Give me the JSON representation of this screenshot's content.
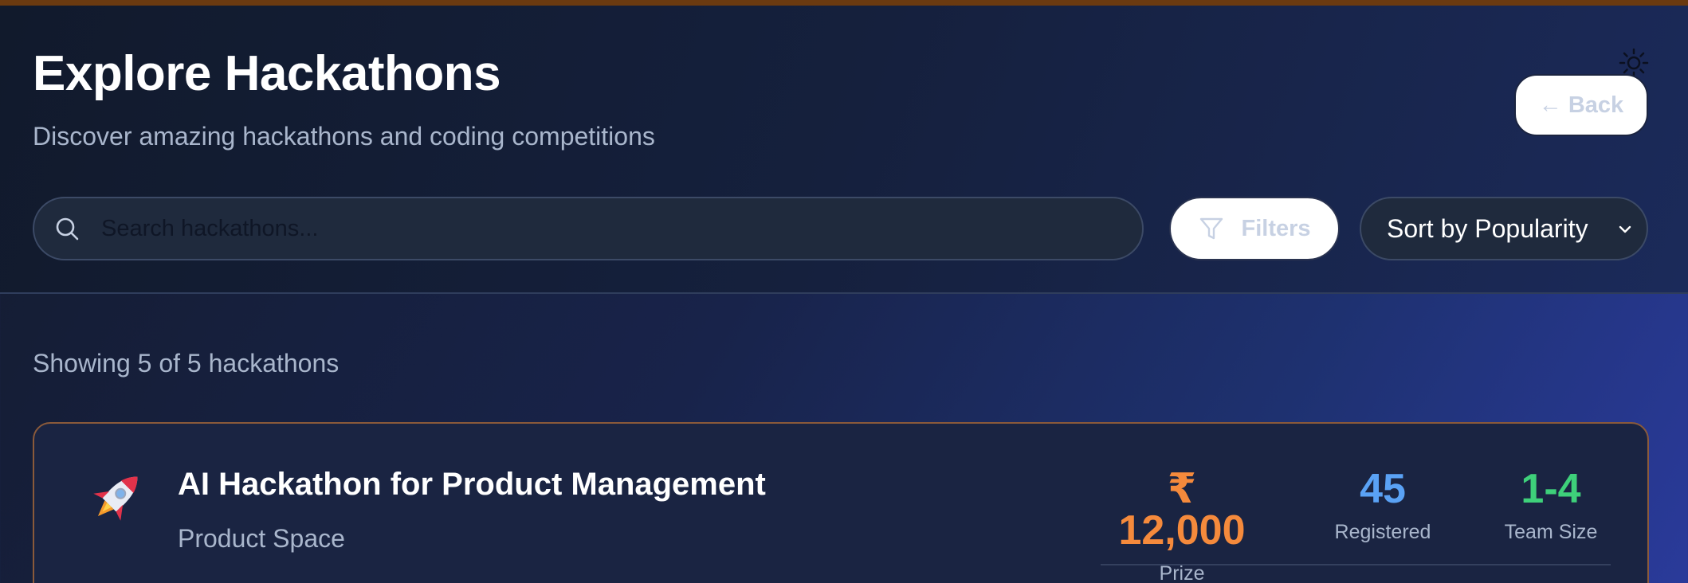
{
  "header": {
    "title": "Explore Hackathons",
    "subtitle": "Discover amazing hackathons and coding competitions",
    "back_label": "← Back",
    "theme_icon": "sun-icon"
  },
  "search": {
    "placeholder": "Search hackathons...",
    "value": ""
  },
  "filters": {
    "label": "Filters",
    "icon": "funnel-icon"
  },
  "sort": {
    "selected": "Sort by Popularity"
  },
  "results": {
    "count_text": "Showing 5 of 5 hackathons"
  },
  "hackathons": [
    {
      "icon": "rocket-icon",
      "title": "AI Hackathon for Product Management",
      "organizer": "Product Space",
      "prize": "₹ 12,000",
      "prize_label": "Prize",
      "registered": "45",
      "registered_label": "Registered",
      "team_size": "1-4",
      "team_size_label": "Team Size"
    }
  ],
  "colors": {
    "accent_orange": "#f58a3c",
    "accent_blue": "#5aa2f5",
    "accent_green": "#3ed07a",
    "card_border": "#8a5a3a"
  }
}
